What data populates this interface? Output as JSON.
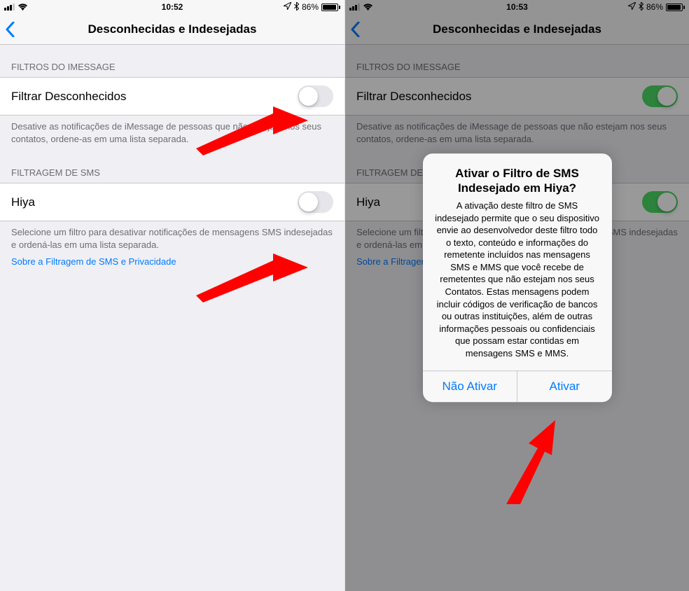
{
  "left": {
    "statusbar": {
      "time": "10:52",
      "battery": "86%",
      "location": "➤",
      "bluetooth": "✽"
    },
    "nav": {
      "title": "Desconhecidas e Indesejadas"
    },
    "section1": {
      "header": "FILTROS DO IMESSAGE",
      "filterLabel": "Filtrar Desconhecidos",
      "footer": "Desative as notificações de iMessage de pessoas que não estejam nos seus contatos, ordene-as em uma lista separada."
    },
    "section2": {
      "header": "FILTRAGEM DE SMS",
      "hiyaLabel": "Hiya",
      "footer": "Selecione um filtro para desativar notificações de mensagens SMS indesejadas e ordená-las em uma lista separada.",
      "link": "Sobre a Filtragem de SMS e Privacidade"
    }
  },
  "right": {
    "statusbar": {
      "time": "10:53",
      "battery": "86%",
      "location": "➤",
      "bluetooth": "✽"
    },
    "nav": {
      "title": "Desconhecidas e Indesejadas"
    },
    "section1": {
      "header": "FILTROS DO IMESSAGE",
      "filterLabel": "Filtrar Desconhecidos",
      "footer": "Desative as notificações de iMessage de pessoas que não estejam nos seus contatos, ordene-as em uma lista separada."
    },
    "section2": {
      "header": "FILTRAGEM DE SMS",
      "hiyaLabel": "Hiya",
      "footer": "Selecione um filtro para desativar notificações de mensagens SMS indesejadas e ordená-las em uma lista separada.",
      "link": "Sobre a Filtragem de SMS e Privacidade"
    },
    "alert": {
      "title": "Ativar o Filtro de SMS Indesejado em Hiya?",
      "message": "A ativação deste filtro de SMS indesejado permite que o seu dispositivo envie ao desenvolvedor deste filtro todo o texto, conteúdo e informações do remetente incluídos nas mensagens SMS e MMS que você recebe de remetentes que não estejam nos seus Contatos. Estas mensagens podem incluir códigos de verificação de bancos ou outras instituições, além de outras informações pessoais ou confidenciais que possam estar contidas em mensagens SMS e MMS.",
      "cancel": "Não Ativar",
      "confirm": "Ativar"
    }
  }
}
